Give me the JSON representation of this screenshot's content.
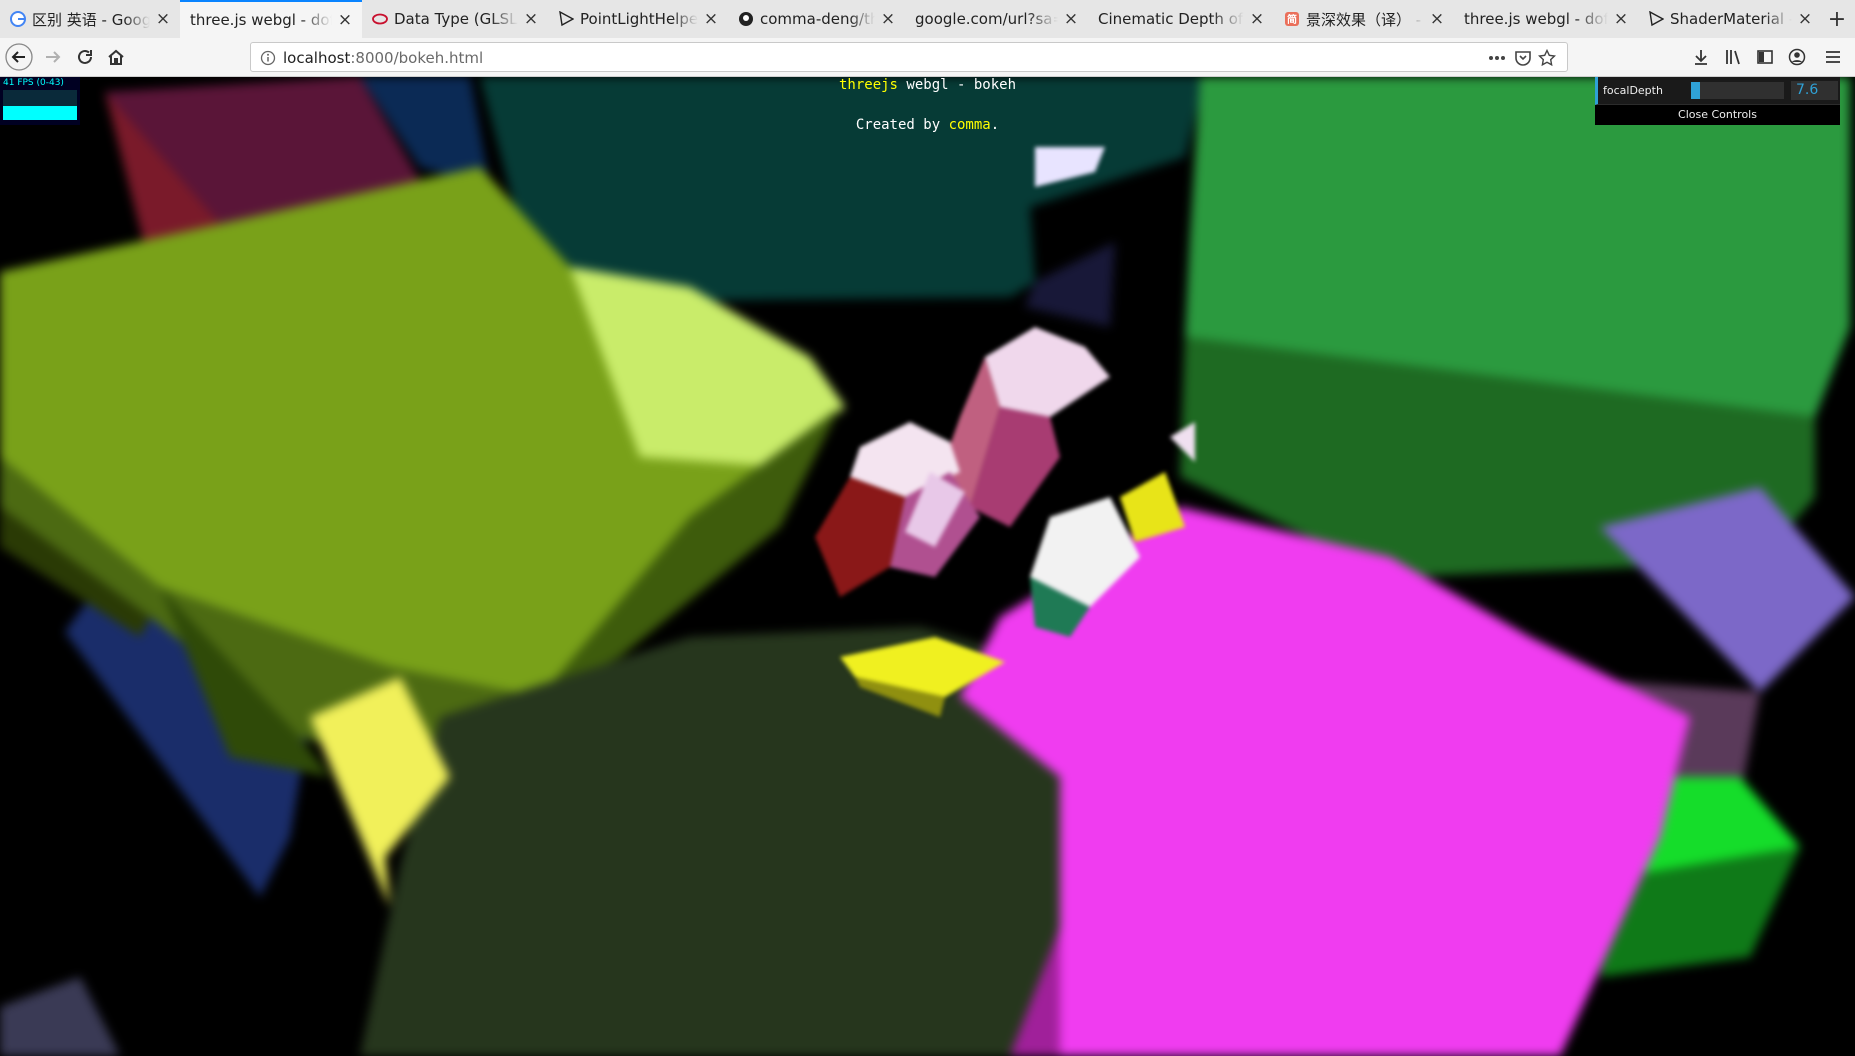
{
  "tabs": [
    {
      "title": "区别 英语 - Google 搜索",
      "favicon": "google-icon",
      "active": false
    },
    {
      "title": "three.js webgl - dof bokeh",
      "favicon": "",
      "active": true
    },
    {
      "title": "Data Type (GLSL) - OpenGL Wiki",
      "favicon": "opengl-icon",
      "active": false
    },
    {
      "title": "PointLightHelper - three.js docs",
      "favicon": "threejs-icon",
      "active": false
    },
    {
      "title": "comma-deng/three.js",
      "favicon": "github-icon",
      "active": false
    },
    {
      "title": "google.com/url?sa=t",
      "favicon": "",
      "active": false
    },
    {
      "title": "Cinematic Depth of Field",
      "favicon": "",
      "active": false
    },
    {
      "title": "景深效果（译） - 简书",
      "favicon": "jianshu-icon",
      "active": false
    },
    {
      "title": "three.js webgl - dof bokeh",
      "favicon": "",
      "active": false
    },
    {
      "title": "ShaderMaterial - three.js docs",
      "favicon": "threejs-icon",
      "active": false
    }
  ],
  "nav": {
    "url_host": "localhost",
    "url_rest": ":8000/bokeh.html"
  },
  "page": {
    "title_link": "threejs",
    "title_rest": " webgl - bokeh",
    "credit_prefix": "Created by ",
    "credit_link": "comma",
    "credit_suffix": "."
  },
  "stats": {
    "fps_text": "41 FPS (0-43)",
    "fps_level": 0.47
  },
  "gui": {
    "param_label": "focalDepth",
    "param_value": "7.6",
    "slider_fraction": 0.1,
    "close_label": "Close Controls"
  },
  "colors": {
    "accent": "#0a84ff",
    "gui_accent": "#2fa1d6",
    "link_yellow": "#ffff00"
  }
}
